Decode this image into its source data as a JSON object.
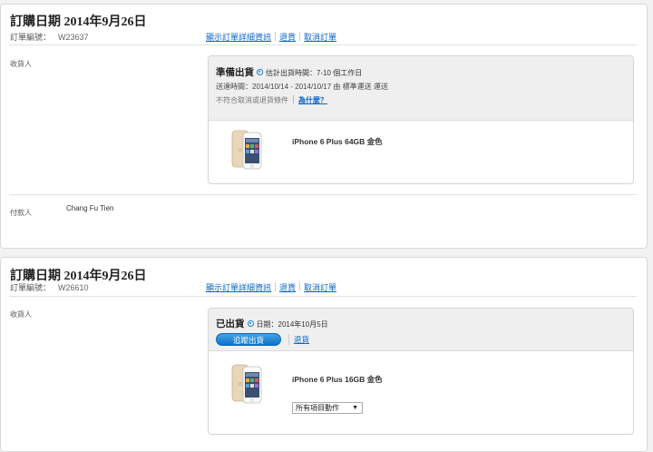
{
  "orders": [
    {
      "date_title": "訂購日期 2014年9月26日",
      "order_number_label": "訂單編號：",
      "order_number": "W23637",
      "links": {
        "details": "顯示訂單詳細資訊",
        "return": "退貨",
        "cancel": "取消訂單"
      },
      "recipient_label": "收貨人",
      "shipment": {
        "status": "準備出貨",
        "estimate": "估計出貨時間：7-10 個工作日",
        "delivery": "送達時間：2014/10/14 - 2014/10/17 由 標準運送 運送",
        "not_eligible": "不符合取消或退貨條件",
        "why_link": "為什麼？",
        "product_name": "iPhone 6 Plus 64GB 金色"
      },
      "payer_label": "付款人",
      "payer_name": "Chang Fu Tien"
    },
    {
      "date_title": "訂購日期 2014年9月26日",
      "order_number_label": "訂單編號：",
      "order_number": "W26610",
      "links": {
        "details": "顯示訂單詳細資訊",
        "return": "退貨",
        "cancel": "取消訂單"
      },
      "recipient_label": "收貨人",
      "shipment": {
        "status": "已出貨",
        "estimate": "日期：2014年10月5日",
        "track_button": "追蹤出貨",
        "return_link": "退貨",
        "product_name": "iPhone 6 Plus 16GB 金色",
        "actions_select": "所有項目動作"
      }
    }
  ],
  "colors": {
    "link": "#0a64c8",
    "button": "#1a82d6",
    "status_icon": "#0a7ad1"
  }
}
